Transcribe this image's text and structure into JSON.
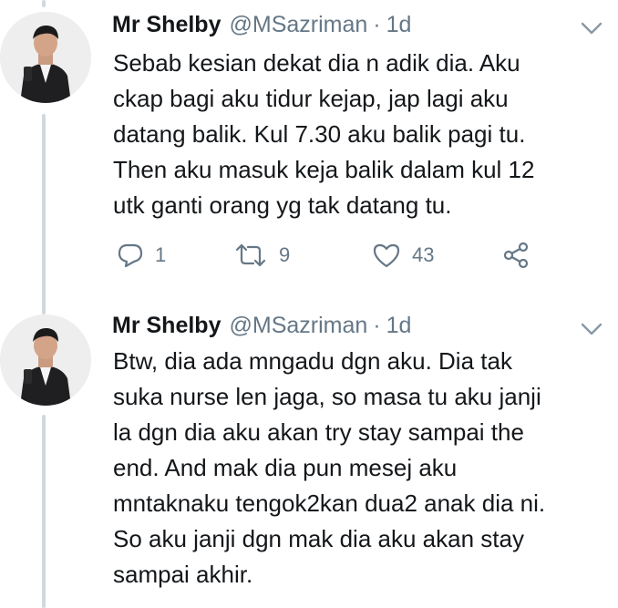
{
  "tweets": [
    {
      "name": "Mr Shelby",
      "handle": "@MSazriman",
      "separator": "·",
      "time": "1d",
      "text_lines": [
        "Sebab kesian dekat dia n adik dia. Aku",
        "ckap bagi aku tidur kejap, jap lagi aku",
        "datang balik. Kul 7.30 aku balik pagi tu.",
        "Then aku masuk keja balik dalam kul 12",
        "utk ganti orang yg tak datang tu."
      ],
      "actions": {
        "reply_count": "1",
        "retweet_count": "9",
        "like_count": "43"
      }
    },
    {
      "name": "Mr Shelby",
      "handle": "@MSazriman",
      "separator": "·",
      "time": "1d",
      "text_lines": [
        "Btw, dia ada mngadu dgn aku. Dia tak",
        "suka nurse len jaga, so masa tu aku janji",
        "la dgn dia aku akan try stay sampai the",
        "end. And mak dia pun mesej aku",
        "mntaknaku tengok2kan dua2 anak dia ni.",
        "So aku janji dgn mak dia aku akan stay",
        "sampai akhir."
      ]
    }
  ],
  "icons": {
    "reply": "reply-icon",
    "retweet": "retweet-icon",
    "like": "heart-icon",
    "share": "share-icon",
    "caret": "chevron-down-icon"
  },
  "colors": {
    "text": "#14171a",
    "secondary": "#657786",
    "thread_line": "#cfd9de"
  }
}
